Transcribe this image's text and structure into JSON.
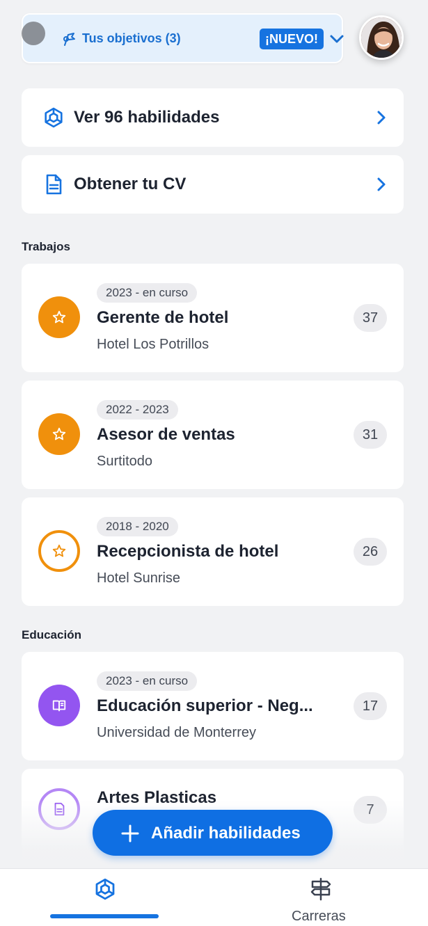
{
  "colors": {
    "accent": "#1673e0",
    "job_orange": "#f0900c",
    "education_purple": "#9355f0",
    "background": "#f1f2f4"
  },
  "goals": {
    "label": "Tus objetivos (3)",
    "badge": "¡NUEVO!",
    "icon": "target-flag-icon",
    "expand_icon": "chevron-down-icon"
  },
  "profile": {
    "avatar_icon": "user-avatar"
  },
  "actions": [
    {
      "label": "Ver 96 habilidades",
      "icon": "hexagon-skills-icon"
    },
    {
      "label": "Obtener tu CV",
      "icon": "document-icon"
    }
  ],
  "sections": {
    "jobs_title": "Trabajos",
    "education_title": "Educación"
  },
  "jobs": [
    {
      "period": "2023 - en curso",
      "title": "Gerente de hotel",
      "subtitle": "Hotel Los Potrillos",
      "count": "37",
      "icon": "star-icon",
      "style": "filled"
    },
    {
      "period": "2022 - 2023",
      "title": "Asesor de ventas",
      "subtitle": "Surtitodo",
      "count": "31",
      "icon": "star-icon",
      "style": "filled"
    },
    {
      "period": "2018 - 2020",
      "title": "Recepcionista de hotel",
      "subtitle": "Hotel Sunrise",
      "count": "26",
      "icon": "star-icon",
      "style": "outline"
    }
  ],
  "education": [
    {
      "period": "2023 - en curso",
      "title": "Educación superior - Neg...",
      "subtitle": "Universidad de Monterrey",
      "count": "17",
      "icon": "book-icon",
      "style": "filled"
    },
    {
      "title": "Artes Plasticas",
      "count": "7",
      "icon": "certificate-icon",
      "style": "outline"
    }
  ],
  "fab": {
    "label": "Añadir habilidades",
    "icon": "plus-icon"
  },
  "bottom_nav": {
    "items": [
      {
        "icon": "hexagon-skills-icon",
        "label": "",
        "active": true
      },
      {
        "icon": "signpost-icon",
        "label": "Carreras",
        "active": false
      }
    ]
  }
}
